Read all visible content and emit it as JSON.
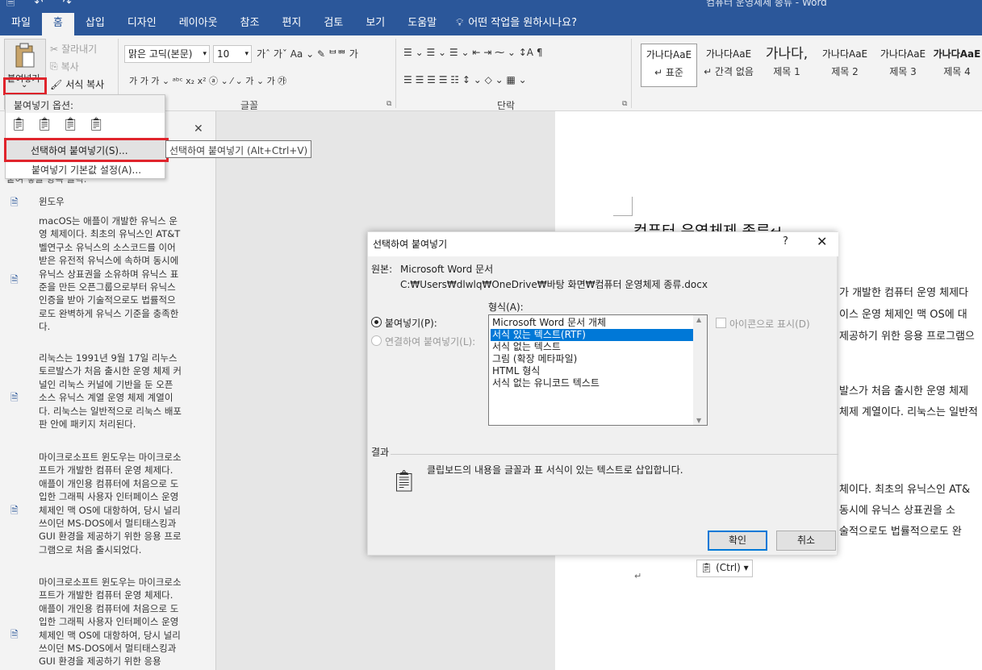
{
  "title_bar": {
    "quick_access": "🗎 ↶ ↷",
    "document_title": "컴퓨터 운영체제 종류 - Word"
  },
  "tabs": [
    "파일",
    "홈",
    "삽입",
    "디자인",
    "레이아웃",
    "참조",
    "편지",
    "검토",
    "보기",
    "도움말"
  ],
  "tell_me": "어떤 작업을 원하시나요?",
  "ribbon": {
    "paste_label": "붙여넣기",
    "paste_arrow": "⌄",
    "cut": "잘라내기",
    "copy": "복사",
    "format_painter": "서식 복사",
    "font_name": "맑은 고딕(본문)",
    "font_size": "10",
    "font_buttons_1": "가ˆ 가ˇ   Aa ⌄   ✎  ᄇᄈ  가",
    "font_buttons_2": "가  가  가 ⌄ ᵃᵇᶜ  x₂  x²   ⓐ ⌄  ⁄ ⌄  가 ⌄   가  ㉮",
    "font_group": "글꼴",
    "para_buttons_1": "☰ ⌄  ☰ ⌄  ☰ ⌄   ⇤  ⇥   ⁓ ⌄   ↕A   ¶",
    "para_buttons_2": "☰  ☰  ☰  ☰  ☷   ↕ ⌄   ◇ ⌄   ▦ ⌄",
    "para_group": "단락",
    "styles": [
      {
        "preview": "가나다AaE",
        "name": "↵ 표준"
      },
      {
        "preview": "가나다AaE",
        "name": "↵ 간격 없음"
      },
      {
        "preview": "가나다,",
        "name": "제목 1"
      },
      {
        "preview": "가나다AaE",
        "name": "제목 2"
      },
      {
        "preview": "가나다AaE",
        "name": "제목 3"
      },
      {
        "preview": "가나다AaE",
        "name": "제목 4"
      }
    ]
  },
  "paste_menu": {
    "header": "붙여넣기 옵션:",
    "icons": [
      "paste-keep-source",
      "paste-merge",
      "paste-picture",
      "paste-text-only"
    ],
    "special": "선택하여 붙여넣기(S)...",
    "default": "붙여넣기 기본값 설정(A)...",
    "tooltip": "선택하여 붙여넣기 (Alt+Ctrl+V)"
  },
  "nav_pane": {
    "close": "✕",
    "hint": "붙여 넣을 항목 클릭:",
    "items": [
      {
        "text": "윈도우"
      },
      {
        "text": "macOS는 애플이 개발한 유닉스 운영 체제이다. 최초의 유닉스인 AT&T 벨연구소 유닉스의 소스코드를 이어받은 유전적 유닉스에 속하며 동시에 유닉스 상표권을 소유하며 유닉스 표준을 만든 오픈그룹으로부터 유닉스 인증을 받아 기술적으로도 법률적으로도 완벽하게 유닉스 기준을 충족한다."
      },
      {
        "text": "리눅스는 1991년 9월 17일 리누스 토르발스가 처음 출시한 운영 체제 커널인 리눅스 커널에 기반을 둔 오픈 소스 유닉스 계열 운영 체제 계열이다. 리눅스는 일반적으로 리눅스 배포판 안에 패키지 처리된다."
      },
      {
        "text": "마이크로소프트 윈도우는 마이크로소프트가 개발한 컴퓨터 운영 체제다. 애플이 개인용 컴퓨터에 처음으로 도입한 그래픽 사용자 인터페이스 운영 체제인 맥 OS에 대항하여, 당시 널리 쓰이던 MS-DOS에서 멀티태스킹과 GUI 환경을 제공하기 위한 응용 프로그램으로 처음 출시되었다."
      },
      {
        "text": "마이크로소프트 윈도우는 마이크로소프트가 개발한 컴퓨터 운영 체제다. 애플이 개인용 컴퓨터에 처음으로 도입한 그래픽 사용자 인터페이스 운영 체제인 맥 OS에 대항하여, 당시 널리 쓰이던 MS-DOS에서 멀티태스킹과 GUI 환경을 제공하기 위한 응용"
      }
    ]
  },
  "document": {
    "title": "컴퓨터 운영체제 종류↵",
    "lines": [
      "가 개발한 컴퓨터 운영 체제다",
      "이스 운영 체제인 맥 OS에 대",
      "제공하기 위한 응용 프로그램으",
      "발스가 처음 출시한 운영 체제",
      "체제 계열이다. 리눅스는 일반적",
      "체이다. 최초의 유닉스인 AT&",
      "동시에 유닉스 상표권을 소",
      "술적으로도 법률적으로도 완"
    ],
    "ctrl_pill": "(Ctrl) ▾",
    "end_mark": "↵"
  },
  "dialog": {
    "title": "선택하여 붙여넣기",
    "help": "?",
    "close": "✕",
    "source_label": "원본:",
    "source_app": "Microsoft Word 문서",
    "source_path": "C:₩Users₩dlwlq₩OneDrive₩바탕 화면₩컴퓨터 운영체제 종류.docx",
    "format_label": "형식(A):",
    "radio_paste": "붙여넣기(P):",
    "radio_link": "연결하여 붙여넣기(L):",
    "formats": [
      "Microsoft Word 문서 개체",
      "서식 있는 텍스트(RTF)",
      "서식 없는 텍스트",
      "그림 (확장 메타파일)",
      "HTML 형식",
      "서식 없는 유니코드 텍스트"
    ],
    "selected_format": "서식 있는 텍스트(RTF)",
    "display_as_icon": "아이콘으로 표시(D)",
    "result_label": "결과",
    "result_text": "클립보드의 내용을 글꼴과 표 서식이 있는 텍스트로 삽입합니다.",
    "ok": "확인",
    "cancel": "취소"
  },
  "colors": {
    "accent": "#2b579a",
    "highlight_red": "#e0242c",
    "selection": "#0078d7"
  }
}
